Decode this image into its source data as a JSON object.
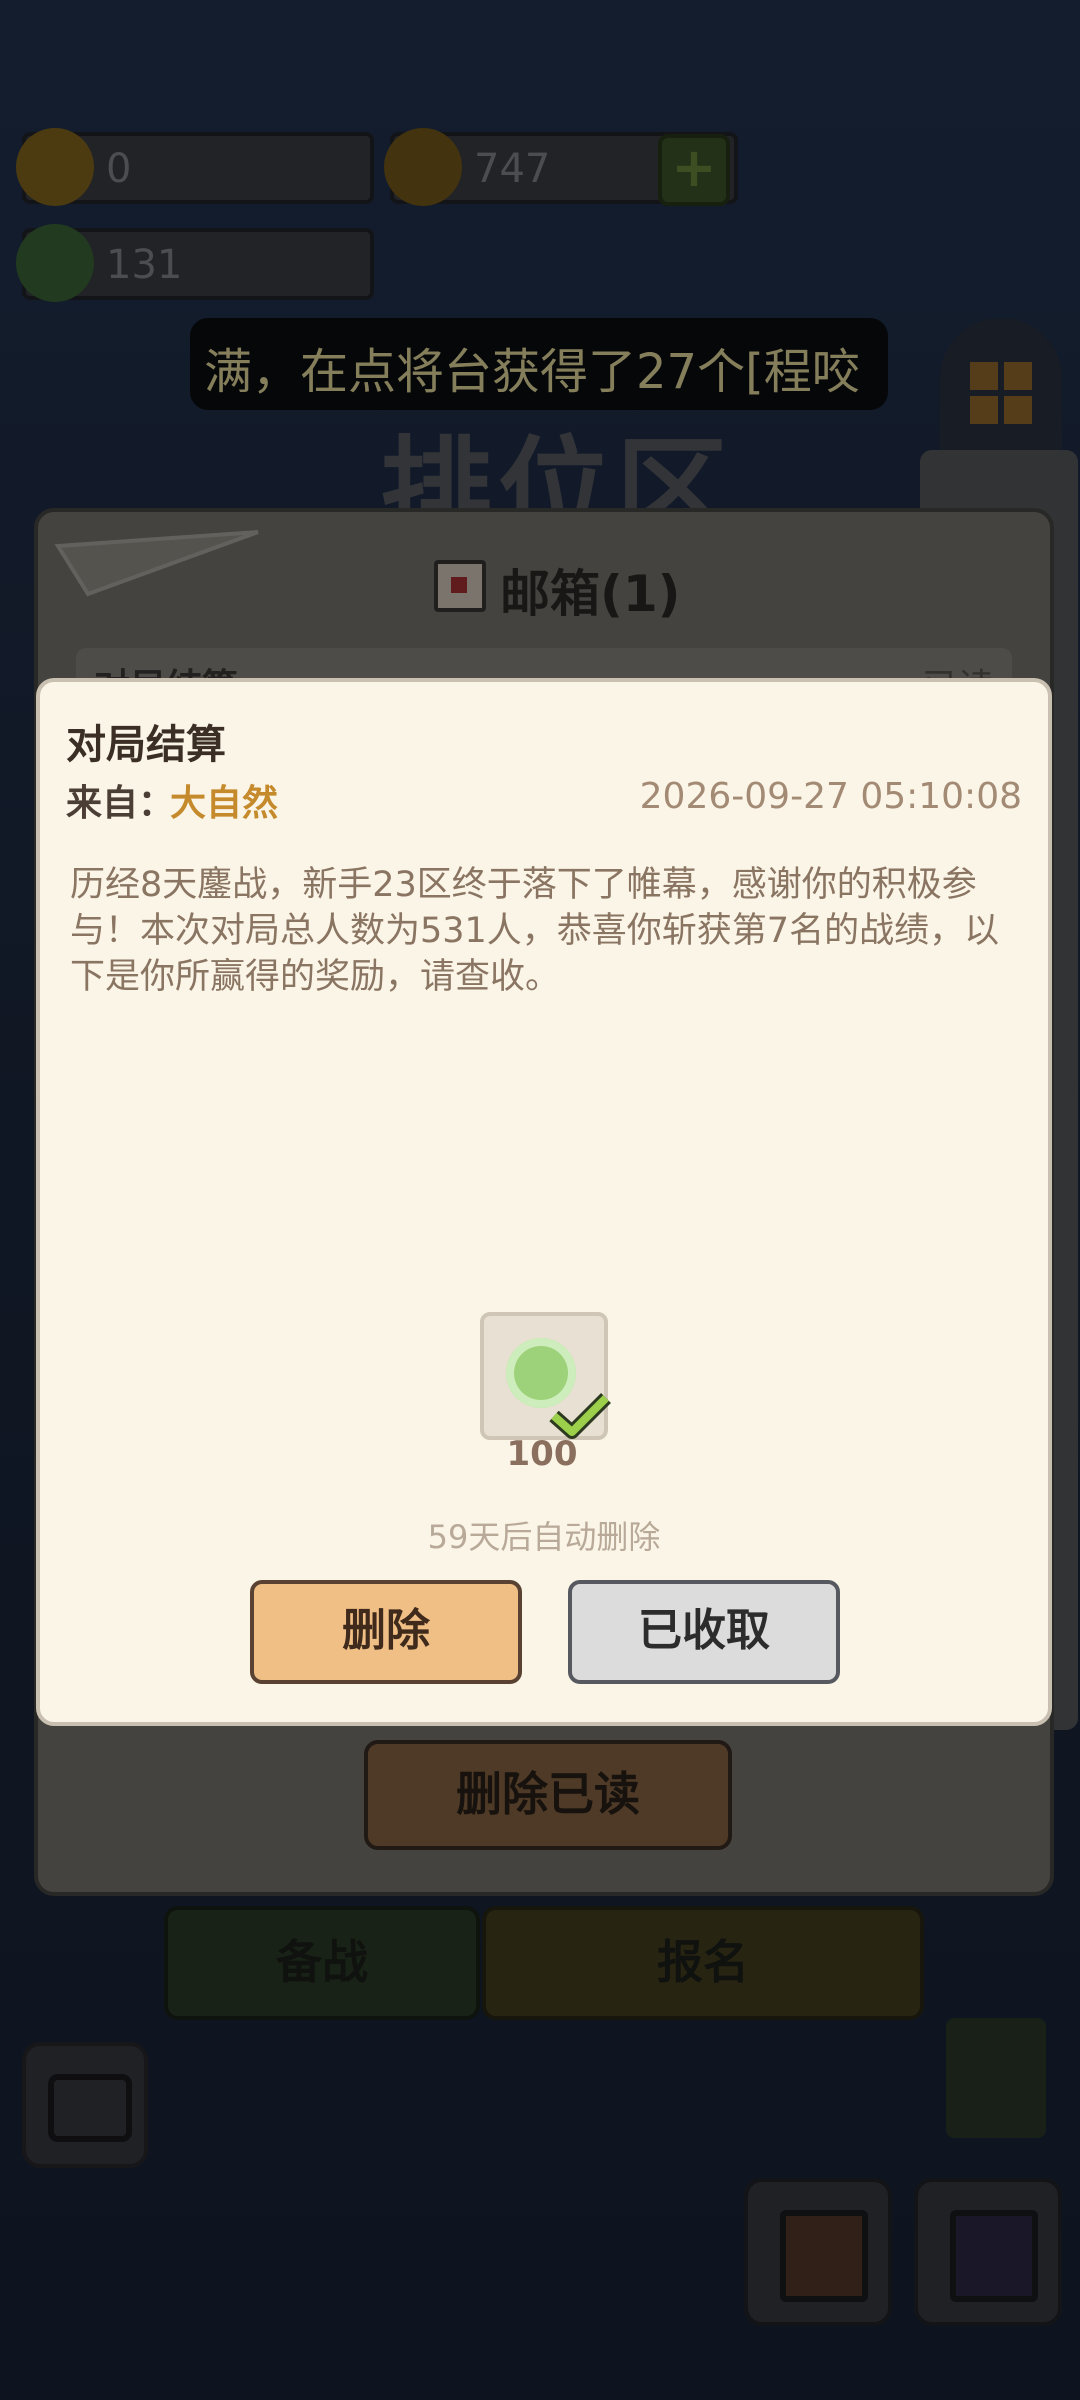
{
  "currencies": {
    "gold_ingot": {
      "value": "0",
      "icon": "gold-ingot-icon"
    },
    "coin": {
      "value": "747",
      "icon": "coin-icon"
    },
    "gem": {
      "value": "131",
      "icon": "green-gem-icon"
    }
  },
  "marquee": {
    "text": "满，在点将台获得了27个[程咬"
  },
  "background": {
    "title": "排位区"
  },
  "mailbox": {
    "title": "邮箱(1)",
    "list_item": {
      "title": "对局结算",
      "status": "已读"
    },
    "delete_read_label": "删除已读"
  },
  "mail": {
    "title": "对局结算",
    "from_label": "来自：",
    "from_value": "大自然",
    "date": "2026-09-27 05:10:08",
    "body": "历经8天鏖战，新手23区终于落下了帷幕，感谢你的积极参与！本次对局总人数为531人，恭喜你斩获第7名的战绩，以下是你所赢得的奖励，请查收。",
    "reward": {
      "icon": "green-gem-icon",
      "count": "100",
      "claimed": true
    },
    "auto_delete": "59天后自动删除",
    "delete_label": "删除",
    "collected_label": "已收取"
  },
  "bottom_nav": {
    "prepare_label": "备战",
    "signup_label": "报名"
  },
  "colors": {
    "dialog_bg": "#fbf5e7",
    "accent_orange": "#f0bf86",
    "sender_color": "#c58a2c",
    "marquee_text": "#f3e6a7"
  }
}
